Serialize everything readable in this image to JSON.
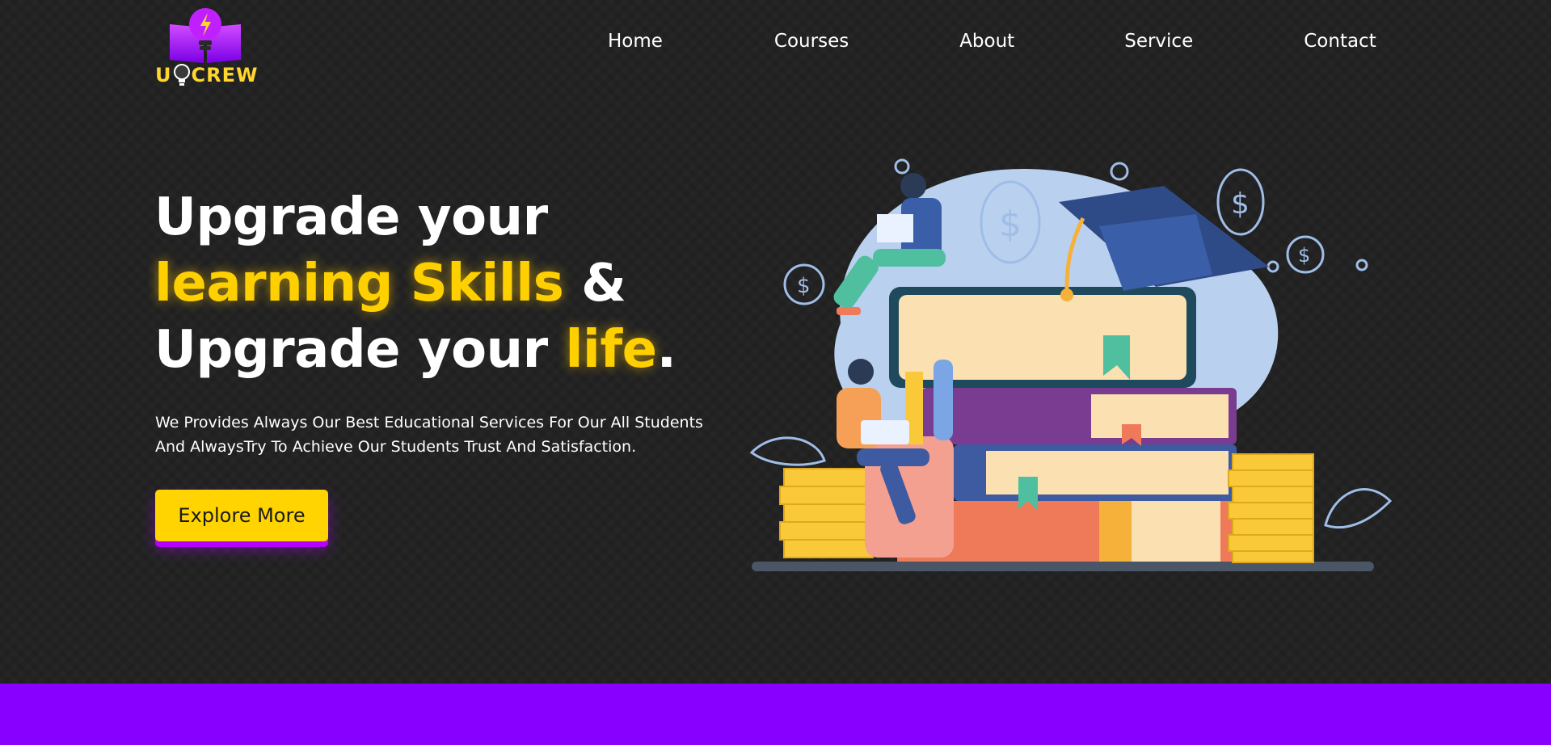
{
  "brand": {
    "logo_text_left": "U",
    "logo_text_right": "CREW"
  },
  "nav": {
    "items": [
      {
        "label": "Home"
      },
      {
        "label": "Courses"
      },
      {
        "label": "About"
      },
      {
        "label": "Service"
      },
      {
        "label": "Contact"
      }
    ]
  },
  "hero": {
    "line1": "Upgrade your",
    "line2_highlight": "learning Skills",
    "line2_rest": " &",
    "line3_start": "Upgrade your ",
    "line3_highlight": "life",
    "line3_end": ".",
    "description_line1": "We Provides Always Our Best Educational Services For Our All Students",
    "description_line2": "And AlwaysTry To Achieve Our Students Trust And Satisfaction.",
    "button_label": "Explore More"
  },
  "colors": {
    "background": "#202020",
    "accent_yellow": "#ffd400",
    "accent_purple": "#8800ff"
  }
}
